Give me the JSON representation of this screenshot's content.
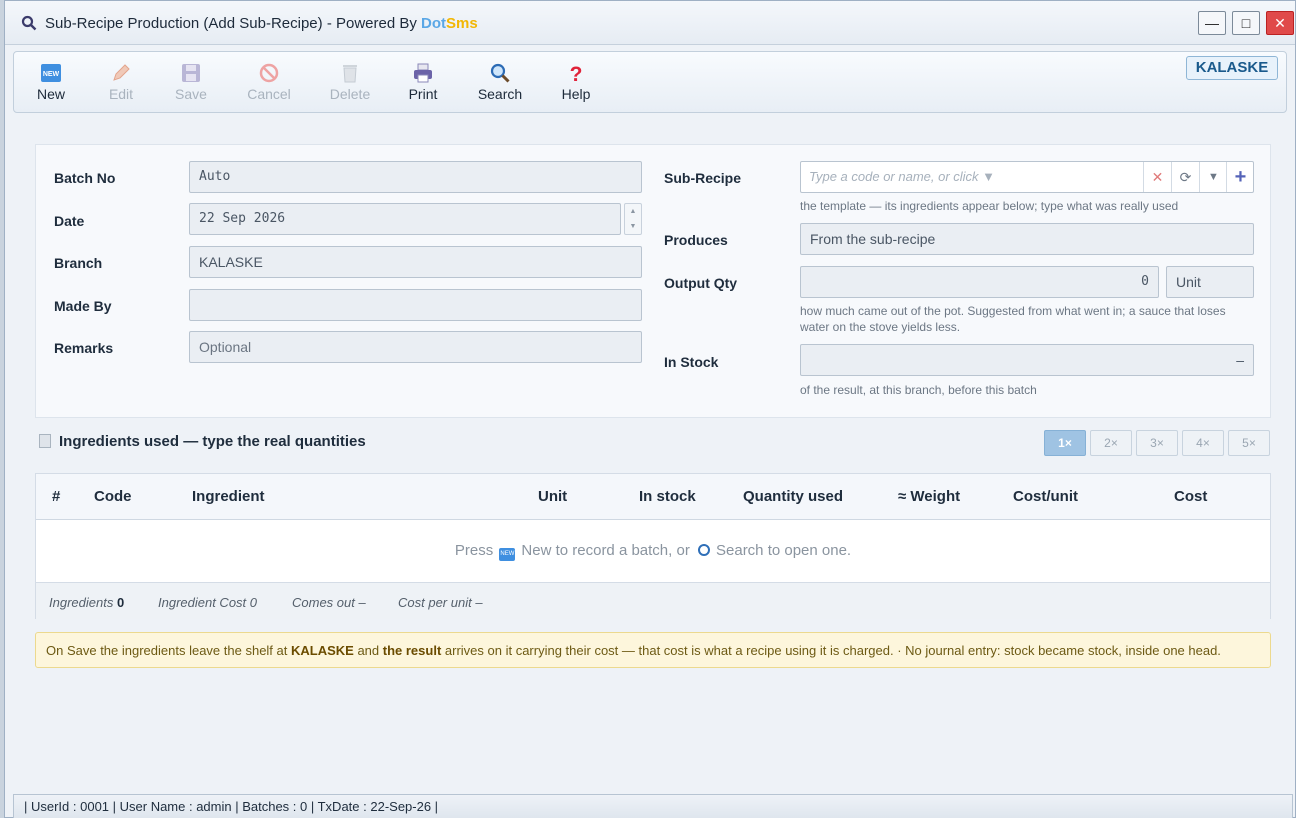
{
  "window": {
    "title": "Sub-Recipe Production (Add Sub-Recipe) - Powered By ",
    "brand_a": "Dot",
    "brand_b": "Sms",
    "controls": {
      "minimize": "—",
      "maximize": "□",
      "close": "✕"
    }
  },
  "toolbar": {
    "new": "New",
    "edit": "Edit",
    "save": "Save",
    "cancel": "Cancel",
    "delete": "Delete",
    "print": "Print",
    "search": "Search",
    "help": "Help",
    "branch_badge": "KALASKE"
  },
  "form": {
    "batch_no_label": "Batch No",
    "batch_no_value": "Auto",
    "date_label": "Date",
    "date_value": "22 Sep 2026",
    "branch_label": "Branch",
    "branch_value": "KALASKE",
    "made_by_label": "Made By",
    "made_by_value": "",
    "remarks_label": "Remarks",
    "remarks_placeholder": "Optional",
    "sub_recipe_label": "Sub-Recipe",
    "sub_recipe_placeholder": "Type a code or name, or click ▼",
    "sub_recipe_hint": "the template — its ingredients appear below; type what was really used",
    "produces_label": "Produces",
    "produces_value": "From the sub-recipe",
    "output_qty_label": "Output Qty",
    "output_qty_value": "0",
    "output_unit": "Unit",
    "output_hint_1": "how much came out of the pot. Suggested from what went in; a sauce that loses",
    "output_hint_2": "water on the stove yields less.",
    "in_stock_label": "In Stock",
    "in_stock_value": "–",
    "in_stock_hint": "of the result, at this branch, before this batch"
  },
  "ingredients": {
    "heading": "Ingredients used — type the real quantities",
    "multipliers": [
      "1×",
      "2×",
      "3×",
      "4×",
      "5×"
    ],
    "columns": [
      "#",
      "Code",
      "Ingredient",
      "Unit",
      "In stock",
      "Quantity used",
      "≈ Weight",
      "Cost/unit",
      "Cost"
    ],
    "empty_press": "Press",
    "empty_new": "New to record a batch, or",
    "empty_search": "Search to open one.",
    "footer_ingredients_label": "Ingredients",
    "footer_ingredients_value": "0",
    "footer_cost_label": "Ingredient Cost",
    "footer_cost_value": "0",
    "footer_comes_out": "Comes out –",
    "footer_cost_per_unit": "Cost per unit –"
  },
  "note": {
    "part1": "On Save the ingredients leave the shelf at ",
    "branch": "KALASKE",
    "part2": " and ",
    "result": "the result",
    "part3": " arrives on it carrying their cost — that cost is what a recipe using it is charged. · No journal entry: stock became stock, inside one head."
  },
  "status": {
    "text": "| UserId : 0001  |  User Name : admin  |  Batches : 0  |  TxDate : 22-Sep-26 |"
  }
}
